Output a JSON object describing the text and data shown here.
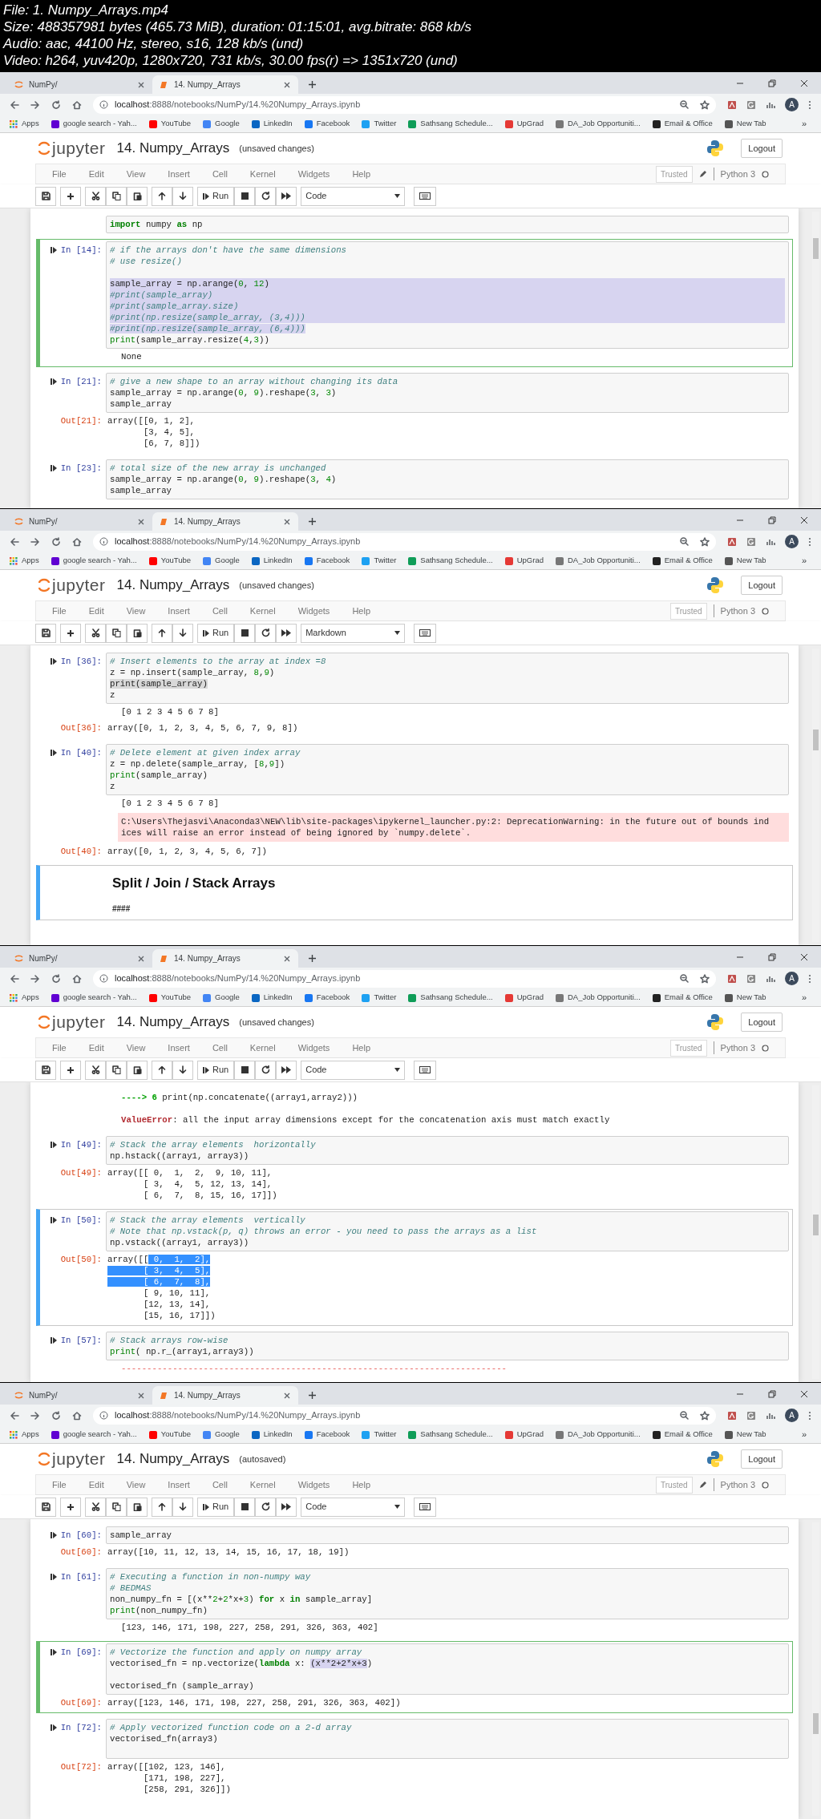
{
  "file_info": {
    "lines": [
      "File: 1. Numpy_Arrays.mp4",
      "Size: 488357981 bytes (465.73 MiB), duration: 01:15:01, avg.bitrate: 868 kb/s",
      "Audio: aac, 44100 Hz, stereo, s16, 128 kb/s (und)",
      "Video: h264, yuv420p, 1280x720, 731 kb/s, 30.00 fps(r) => 1351x720 (und)"
    ]
  },
  "frames": [
    {
      "tabs": [
        {
          "label": "NumPy/",
          "selected": false
        },
        {
          "label": "14. Numpy_Arrays",
          "selected": true
        }
      ],
      "url": {
        "host": "localhost",
        "rest": ":8888/notebooks/NumPy/14.%20Numpy_Arrays.ipynb"
      },
      "profile": "A",
      "bookmarks": [
        "Apps",
        "google search - Yah...",
        "YouTube",
        "Google",
        "LinkedIn",
        "Facebook",
        "Twitter",
        "Sathsang Schedule...",
        "UpGrad",
        "DA_Job Opportuniti...",
        "Email & Office",
        "New Tab"
      ],
      "bookmarks_more": "»",
      "notebook": {
        "logo_text": "jupyter",
        "title": "14. Numpy_Arrays",
        "save_status": "(unsaved changes)",
        "logout": "Logout",
        "menu": [
          "File",
          "Edit",
          "View",
          "Insert",
          "Cell",
          "Kernel",
          "Widgets",
          "Help"
        ],
        "trusted": "Trusted",
        "edit_mode": true,
        "kernel": "Python 3",
        "run": "Run",
        "cell_type": "Code"
      },
      "cells": [
        {
          "kind": "code",
          "selected": false,
          "input": [
            {
              "segments": [
                {
                  "text": "import",
                  "kind": "keyword"
                },
                {
                  "text": " numpy ",
                  "kind": "code"
                },
                {
                  "text": "as",
                  "kind": "keyword"
                },
                {
                  "text": " np",
                  "kind": "code"
                }
              ]
            }
          ]
        },
        {
          "kind": "code",
          "prompt": "In [14]:",
          "selected": true,
          "editing": true,
          "input": [
            {
              "segments": [
                {
                  "text": "# if the arrays don't have the same dimensions",
                  "kind": "comment"
                }
              ]
            },
            {
              "segments": [
                {
                  "text": "# use resize()",
                  "kind": "comment"
                }
              ]
            },
            {
              "kind": "blank"
            },
            {
              "highlighted": true,
              "segments": [
                {
                  "text": "sample_array = np.arange(",
                  "kind": "code"
                },
                {
                  "text": "0",
                  "kind": "number"
                },
                {
                  "text": ", ",
                  "kind": "code"
                },
                {
                  "text": "12",
                  "kind": "number"
                },
                {
                  "text": ")",
                  "kind": "code"
                }
              ]
            },
            {
              "highlighted": true,
              "segments": [
                {
                  "text": "#print(sample_array)",
                  "kind": "comment"
                }
              ]
            },
            {
              "highlighted": true,
              "segments": [
                {
                  "text": "#print(sample_array.size)",
                  "kind": "comment"
                }
              ]
            },
            {
              "highlighted": true,
              "segments": [
                {
                  "text": "#print(np.resize(sample_array, (3,4)))",
                  "kind": "comment"
                }
              ]
            },
            {
              "segments": [
                {
                  "text": "#print(np.resize(sample_array, (6,4)))",
                  "kind": "comment",
                  "highlighted": true
                }
              ]
            },
            {
              "segments": [
                {
                  "text": "print",
                  "kind": "builtin"
                },
                {
                  "text": "(sample_array.resize(",
                  "kind": "code"
                },
                {
                  "text": "4",
                  "kind": "number"
                },
                {
                  "text": ",",
                  "kind": "code"
                },
                {
                  "text": "3",
                  "kind": "number"
                },
                {
                  "text": "))",
                  "kind": "code"
                }
              ]
            }
          ],
          "outputs": [
            {
              "kind": "stream",
              "lines": [
                "None"
              ]
            }
          ]
        },
        {
          "kind": "code",
          "prompt": "In [21]:",
          "selected": false,
          "input": [
            {
              "segments": [
                {
                  "text": "# give a new shape to an array without changing its data",
                  "kind": "comment"
                }
              ]
            },
            {
              "segments": [
                {
                  "text": "sample_array = np.arange(",
                  "kind": "code"
                },
                {
                  "text": "0",
                  "kind": "number"
                },
                {
                  "text": ", ",
                  "kind": "code"
                },
                {
                  "text": "9",
                  "kind": "number"
                },
                {
                  "text": ").reshape(",
                  "kind": "code"
                },
                {
                  "text": "3",
                  "kind": "number"
                },
                {
                  "text": ", ",
                  "kind": "code"
                },
                {
                  "text": "3",
                  "kind": "number"
                },
                {
                  "text": ")",
                  "kind": "code"
                }
              ]
            },
            {
              "segments": [
                {
                  "text": "sample_array",
                  "kind": "code"
                }
              ]
            }
          ],
          "outputs": [
            {
              "kind": "result",
              "prompt": "Out[21]:",
              "lines": [
                "array([[0, 1, 2],",
                "       [3, 4, 5],",
                "       [6, 7, 8]])"
              ]
            }
          ]
        },
        {
          "kind": "code",
          "prompt": "In [23]:",
          "selected": false,
          "input": [
            {
              "segments": [
                {
                  "text": "# total size of the new array is unchanged",
                  "kind": "comment"
                }
              ]
            },
            {
              "segments": [
                {
                  "text": "sample_array = np.arange(",
                  "kind": "code"
                },
                {
                  "text": "0",
                  "kind": "number"
                },
                {
                  "text": ", ",
                  "kind": "code"
                },
                {
                  "text": "9",
                  "kind": "number"
                },
                {
                  "text": ").reshape(",
                  "kind": "code"
                },
                {
                  "text": "3",
                  "kind": "number"
                },
                {
                  "text": ", ",
                  "kind": "code"
                },
                {
                  "text": "4",
                  "kind": "number"
                },
                {
                  "text": ")",
                  "kind": "code"
                }
              ]
            },
            {
              "segments": [
                {
                  "text": "sample_array",
                  "kind": "code"
                }
              ]
            }
          ]
        }
      ]
    },
    {
      "tabs": [
        {
          "label": "NumPy/",
          "selected": false
        },
        {
          "label": "14. Numpy_Arrays",
          "selected": true
        }
      ],
      "url": {
        "host": "localhost",
        "rest": ":8888/notebooks/NumPy/14.%20Numpy_Arrays.ipynb"
      },
      "profile": "A",
      "bookmarks": [
        "Apps",
        "google search - Yah...",
        "YouTube",
        "Google",
        "LinkedIn",
        "Facebook",
        "Twitter",
        "Sathsang Schedule...",
        "UpGrad",
        "DA_Job Opportuniti...",
        "Email & Office",
        "New Tab"
      ],
      "bookmarks_more": "»",
      "notebook": {
        "logo_text": "jupyter",
        "title": "14. Numpy_Arrays",
        "save_status": "(unsaved changes)",
        "logout": "Logout",
        "menu": [
          "File",
          "Edit",
          "View",
          "Insert",
          "Cell",
          "Kernel",
          "Widgets",
          "Help"
        ],
        "trusted": "Trusted",
        "edit_mode": false,
        "kernel": "Python 3",
        "run": "Run",
        "cell_type": "Markdown"
      },
      "cells": [
        {
          "kind": "code",
          "prompt": "In [36]:",
          "selected": false,
          "input": [
            {
              "segments": [
                {
                  "text": "# Insert elements to the array at index =8",
                  "kind": "comment"
                }
              ]
            },
            {
              "segments": [
                {
                  "text": "z = np.insert(sample_array, ",
                  "kind": "code"
                },
                {
                  "text": "8",
                  "kind": "number"
                },
                {
                  "text": ",",
                  "kind": "code"
                },
                {
                  "text": "9",
                  "kind": "number"
                },
                {
                  "text": ")",
                  "kind": "code"
                }
              ]
            },
            {
              "segments": [
                {
                  "text": "print(sample_array)",
                  "kind": "code",
                  "highlighted": true
                }
              ]
            },
            {
              "segments": [
                {
                  "text": "z",
                  "kind": "code"
                }
              ]
            }
          ],
          "outputs": [
            {
              "kind": "stream",
              "lines": [
                "[0 1 2 3 4 5 6 7 8]"
              ]
            },
            {
              "kind": "result",
              "prompt": "Out[36]:",
              "lines": [
                "array([0, 1, 2, 3, 4, 5, 6, 7, 9, 8])"
              ]
            }
          ]
        },
        {
          "kind": "code",
          "prompt": "In [40]:",
          "selected": false,
          "input": [
            {
              "segments": [
                {
                  "text": "# Delete element at given index array",
                  "kind": "comment"
                }
              ]
            },
            {
              "segments": [
                {
                  "text": "z = np.delete(sample_array, [",
                  "kind": "code"
                },
                {
                  "text": "8",
                  "kind": "number"
                },
                {
                  "text": ",",
                  "kind": "code"
                },
                {
                  "text": "9",
                  "kind": "number"
                },
                {
                  "text": "])",
                  "kind": "code"
                }
              ]
            },
            {
              "segments": [
                {
                  "text": "print",
                  "kind": "builtin"
                },
                {
                  "text": "(sample_array)",
                  "kind": "code"
                }
              ]
            },
            {
              "segments": [
                {
                  "text": "z",
                  "kind": "code"
                }
              ]
            }
          ],
          "outputs": [
            {
              "kind": "stream",
              "lines": [
                "[0 1 2 3 4 5 6 7 8]"
              ]
            },
            {
              "kind": "stderr",
              "lines": [
                "C:\\Users\\Thejasvi\\Anaconda3\\NEW\\lib\\site-packages\\ipykernel_launcher.py:2: DeprecationWarning: in the future out of bounds ind",
                "ices will raise an error instead of being ignored by `numpy.delete`."
              ]
            },
            {
              "kind": "result",
              "prompt": "Out[40]:",
              "lines": [
                "array([0, 1, 2, 3, 4, 5, 6, 7])"
              ]
            }
          ]
        },
        {
          "kind": "markdown",
          "selected": true,
          "editing": false,
          "heading": "Split / Join / Stack Arrays",
          "text": "####"
        }
      ]
    },
    {
      "tabs": [
        {
          "label": "NumPy/",
          "selected": false
        },
        {
          "label": "14. Numpy_Arrays",
          "selected": true
        }
      ],
      "url": {
        "host": "localhost",
        "rest": ":8888/notebooks/NumPy/14.%20Numpy_Arrays.ipynb"
      },
      "profile": "A",
      "bookmarks": [
        "Apps",
        "google search - Yah...",
        "YouTube",
        "Google",
        "LinkedIn",
        "Facebook",
        "Twitter",
        "Sathsang Schedule...",
        "UpGrad",
        "DA_Job Opportuniti...",
        "Email & Office",
        "New Tab"
      ],
      "bookmarks_more": "»",
      "notebook": {
        "logo_text": "jupyter",
        "title": "14. Numpy_Arrays",
        "save_status": "(unsaved changes)",
        "logout": "Logout",
        "menu": [
          "File",
          "Edit",
          "View",
          "Insert",
          "Cell",
          "Kernel",
          "Widgets",
          "Help"
        ],
        "trusted": "Trusted",
        "edit_mode": false,
        "kernel": "Python 3",
        "run": "Run",
        "cell_type": "Code"
      },
      "cells": [
        {
          "kind": "code",
          "selected": false,
          "outputs": [
            {
              "kind": "error",
              "lines": [
                {
                  "segments": [
                    {
                      "text": "----> 6",
                      "kind": "tb-arrow"
                    },
                    {
                      "text": " print(np.concatenate((array1,array2)))",
                      "kind": "code"
                    }
                  ]
                },
                {
                  "kind": "blank"
                },
                {
                  "segments": [
                    {
                      "text": "ValueError",
                      "kind": "error-name"
                    },
                    {
                      "text": ": all the input array dimensions except for the concatenation axis must match exactly",
                      "kind": "code"
                    }
                  ]
                }
              ]
            }
          ]
        },
        {
          "kind": "code",
          "prompt": "In [49]:",
          "selected": false,
          "input": [
            {
              "segments": [
                {
                  "text": "# Stack the array elements  horizontally",
                  "kind": "comment"
                }
              ]
            },
            {
              "segments": [
                {
                  "text": "np.hstack((array1, array3))",
                  "kind": "code"
                }
              ]
            }
          ],
          "outputs": [
            {
              "kind": "result",
              "prompt": "Out[49]:",
              "lines": [
                "array([[ 0,  1,  2,  9, 10, 11],",
                "       [ 3,  4,  5, 12, 13, 14],",
                "       [ 6,  7,  8, 15, 16, 17]])"
              ]
            }
          ]
        },
        {
          "kind": "code",
          "prompt": "In [50]:",
          "selected": true,
          "editing": false,
          "input": [
            {
              "segments": [
                {
                  "text": "# Stack the array elements  vertically",
                  "kind": "comment"
                }
              ]
            },
            {
              "segments": [
                {
                  "text": "# Note that np.vstack(p, q) throws an error - you need to pass the arrays as a list",
                  "kind": "comment"
                }
              ]
            },
            {
              "segments": [
                {
                  "text": "np.vstack((array1, array3))",
                  "kind": "code"
                }
              ]
            }
          ],
          "outputs": [
            {
              "kind": "result",
              "prompt": "Out[50]:",
              "lines": [
                {
                  "segments": [
                    {
                      "text": "array([[",
                      "kind": "code"
                    },
                    {
                      "text": " 0,  1,  2],",
                      "kind": "code",
                      "highlighted": true
                    }
                  ]
                },
                {
                  "segments": [
                    {
                      "text": "       [ 3,  4,  5],",
                      "kind": "code",
                      "highlighted": true
                    }
                  ]
                },
                {
                  "segments": [
                    {
                      "text": "       [ 6,  7,  8],",
                      "kind": "code",
                      "highlighted": true
                    }
                  ]
                },
                "       [ 9, 10, 11],",
                "       [12, 13, 14],",
                "       [15, 16, 17]])"
              ]
            }
          ]
        },
        {
          "kind": "code",
          "prompt": "In [57]:",
          "selected": false,
          "input": [
            {
              "segments": [
                {
                  "text": "# Stack arrays row-wise",
                  "kind": "comment"
                }
              ]
            },
            {
              "segments": [
                {
                  "text": "print",
                  "kind": "builtin"
                },
                {
                  "text": "( np.r_(array1,array3))",
                  "kind": "code"
                }
              ]
            }
          ],
          "outputs": [
            {
              "kind": "error",
              "lines": [
                {
                  "segments": [
                    {
                      "text": "---------------------------------------------------------------------------",
                      "kind": "tb-rule"
                    }
                  ]
                }
              ]
            }
          ]
        }
      ]
    },
    {
      "tabs": [
        {
          "label": "NumPy/",
          "selected": false
        },
        {
          "label": "14. Numpy_Arrays",
          "selected": true
        }
      ],
      "url": {
        "host": "localhost",
        "rest": ":8888/notebooks/NumPy/14.%20Numpy_Arrays.ipynb"
      },
      "profile": "A",
      "bookmarks": [
        "Apps",
        "google search - Yah...",
        "YouTube",
        "Google",
        "LinkedIn",
        "Facebook",
        "Twitter",
        "Sathsang Schedule...",
        "UpGrad",
        "DA_Job Opportuniti...",
        "Email & Office",
        "New Tab"
      ],
      "bookmarks_more": "»",
      "notebook": {
        "logo_text": "jupyter",
        "title": "14. Numpy_Arrays",
        "save_status": "(autosaved)",
        "logout": "Logout",
        "menu": [
          "File",
          "Edit",
          "View",
          "Insert",
          "Cell",
          "Kernel",
          "Widgets",
          "Help"
        ],
        "trusted": "Trusted",
        "edit_mode": true,
        "kernel": "Python 3",
        "run": "Run",
        "cell_type": "Code"
      },
      "cells": [
        {
          "kind": "code",
          "prompt": "In [60]:",
          "selected": false,
          "input": [
            {
              "segments": [
                {
                  "text": "sample_array",
                  "kind": "code"
                }
              ]
            }
          ],
          "outputs": [
            {
              "kind": "result",
              "prompt": "Out[60]:",
              "lines": [
                "array([10, 11, 12, 13, 14, 15, 16, 17, 18, 19])"
              ]
            }
          ]
        },
        {
          "kind": "code",
          "prompt": "In [61]:",
          "selected": false,
          "input": [
            {
              "segments": [
                {
                  "text": "# Executing a function in non-numpy way",
                  "kind": "comment"
                }
              ]
            },
            {
              "segments": [
                {
                  "text": "# BEDMAS",
                  "kind": "comment"
                }
              ]
            },
            {
              "segments": [
                {
                  "text": "non_numpy_fn = [(x**",
                  "kind": "code"
                },
                {
                  "text": "2",
                  "kind": "number"
                },
                {
                  "text": "+",
                  "kind": "code"
                },
                {
                  "text": "2",
                  "kind": "number"
                },
                {
                  "text": "*x+",
                  "kind": "code"
                },
                {
                  "text": "3",
                  "kind": "number"
                },
                {
                  "text": ") ",
                  "kind": "code"
                },
                {
                  "text": "for",
                  "kind": "keyword"
                },
                {
                  "text": " x ",
                  "kind": "code"
                },
                {
                  "text": "in",
                  "kind": "keyword"
                },
                {
                  "text": " sample_array]",
                  "kind": "code"
                }
              ]
            },
            {
              "segments": [
                {
                  "text": "print",
                  "kind": "builtin"
                },
                {
                  "text": "(non_numpy_fn)",
                  "kind": "code"
                }
              ]
            }
          ],
          "outputs": [
            {
              "kind": "stream",
              "lines": [
                "[123, 146, 171, 198, 227, 258, 291, 326, 363, 402]"
              ]
            }
          ]
        },
        {
          "kind": "code",
          "prompt": "In [69]:",
          "selected": true,
          "editing": true,
          "input": [
            {
              "segments": [
                {
                  "text": "# Vectorize the function and apply on numpy array",
                  "kind": "comment"
                }
              ]
            },
            {
              "segments": [
                {
                  "text": "vectorised_fn = np.vectorize(",
                  "kind": "code"
                },
                {
                  "text": "lambda",
                  "kind": "keyword"
                },
                {
                  "text": " x: ",
                  "kind": "code"
                },
                {
                  "text": "(x**2+2*x+3",
                  "kind": "code",
                  "highlighted": true
                },
                {
                  "text": ")",
                  "kind": "code"
                }
              ]
            },
            {
              "kind": "blank"
            },
            {
              "segments": [
                {
                  "text": "vectorised_fn (sample_array)",
                  "kind": "code"
                }
              ]
            }
          ],
          "outputs": [
            {
              "kind": "result",
              "prompt": "Out[69]:",
              "lines": [
                "array([123, 146, 171, 198, 227, 258, 291, 326, 363, 402])"
              ]
            }
          ]
        },
        {
          "kind": "code",
          "prompt": "In [72]:",
          "selected": false,
          "input": [
            {
              "segments": [
                {
                  "text": "# Apply vectorized function code on a 2-d array",
                  "kind": "comment"
                }
              ]
            },
            {
              "segments": [
                {
                  "text": "vectorised_fn(array3)",
                  "kind": "code"
                }
              ]
            },
            {
              "kind": "blank"
            }
          ],
          "outputs": [
            {
              "kind": "result",
              "prompt": "Out[72]:",
              "lines": [
                "array([[102, 123, 146],",
                "       [171, 198, 227],",
                "       [258, 291, 326]])"
              ]
            }
          ]
        }
      ]
    }
  ]
}
